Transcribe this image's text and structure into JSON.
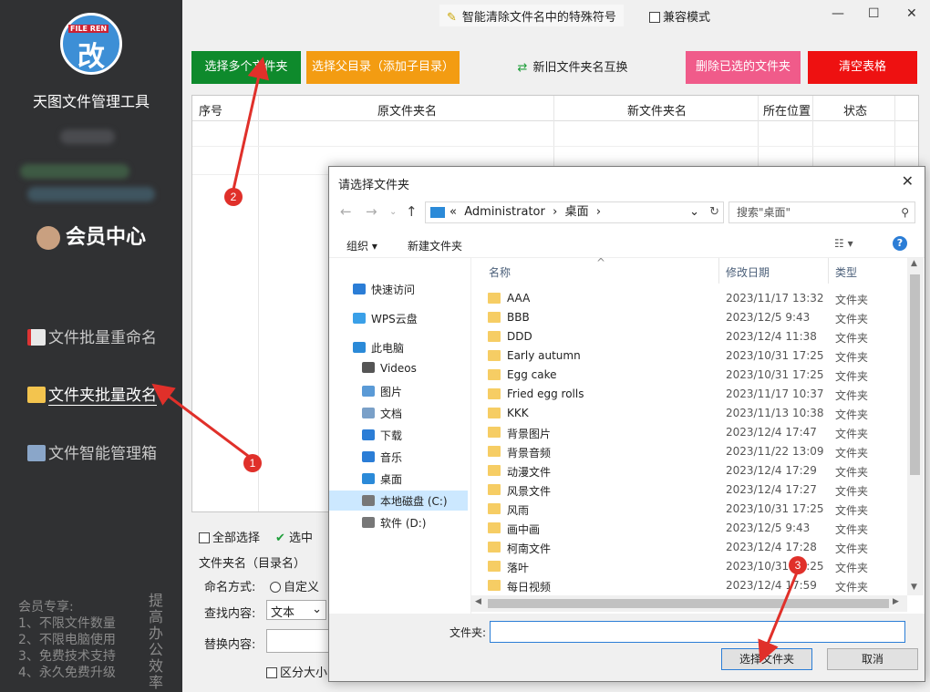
{
  "sidebar": {
    "logo_tag": "FILE REN",
    "logo_char": "改",
    "app_name": "天图文件管理工具",
    "member_center": "会员中心",
    "nav": [
      {
        "label": "文件批量重命名"
      },
      {
        "label": "文件夹批量改名"
      },
      {
        "label": "文件智能管理箱"
      }
    ],
    "vip_lines": [
      "会员专享:",
      "1、不限文件数量",
      "2、不限电脑使用",
      "3、免费技术支持",
      "4、永久免费升级"
    ],
    "vip_side": "提高办公效率"
  },
  "header": {
    "title": "智能清除文件名中的特殊符号",
    "compat_mode": "兼容模式"
  },
  "toolbar": {
    "select_multiple": "选择多个文件夹",
    "select_parent": "选择父目录（添加子目录）",
    "swap": "新旧文件夹名互换",
    "delete_selected": "删除已选的文件夹",
    "clear_table": "清空表格"
  },
  "table": {
    "columns": [
      "序号",
      "原文件夹名",
      "新文件夹名",
      "所在位置",
      "状态"
    ]
  },
  "bottom": {
    "select_all": "全部选择",
    "selected": "选中",
    "folder_name_label": "文件夹名（目录名）",
    "naming_mode": "命名方式:",
    "custom": "自定义",
    "find": "查找内容:",
    "find_type": "文本",
    "replace": "替换内容:",
    "case_sensitive": "区分大小写"
  },
  "dialog": {
    "title": "请选择文件夹",
    "address": [
      "«",
      "Administrator",
      "›",
      "桌面",
      "›"
    ],
    "search_placeholder": "搜索\"桌面\"",
    "organize": "组织 ▾",
    "new_folder": "新建文件夹",
    "tree": [
      {
        "label": "快速访问",
        "color": "#2b7dd6"
      },
      {
        "label": "WPS云盘",
        "color": "#3aa0e8"
      },
      {
        "label": "此电脑",
        "color": "#2b8ad8"
      },
      {
        "label": "Videos",
        "color": "#555"
      },
      {
        "label": "图片",
        "color": "#5a9ad6"
      },
      {
        "label": "文档",
        "color": "#7aa0c8"
      },
      {
        "label": "下载",
        "color": "#2b7dd6"
      },
      {
        "label": "音乐",
        "color": "#2b7dd6"
      },
      {
        "label": "桌面",
        "color": "#2b8ad8"
      },
      {
        "label": "本地磁盘 (C:)",
        "color": "#777"
      },
      {
        "label": "软件 (D:)",
        "color": "#777"
      }
    ],
    "col_name": "名称",
    "col_date": "修改日期",
    "col_type": "类型",
    "files": [
      {
        "name": "AAA",
        "date": "2023/11/17 13:32",
        "type": "文件夹"
      },
      {
        "name": "BBB",
        "date": "2023/12/5 9:43",
        "type": "文件夹"
      },
      {
        "name": "DDD",
        "date": "2023/12/4 11:38",
        "type": "文件夹"
      },
      {
        "name": "Early autumn",
        "date": "2023/10/31 17:25",
        "type": "文件夹"
      },
      {
        "name": "Egg cake",
        "date": "2023/10/31 17:25",
        "type": "文件夹"
      },
      {
        "name": "Fried egg rolls",
        "date": "2023/11/17 10:37",
        "type": "文件夹"
      },
      {
        "name": "KKK",
        "date": "2023/11/13 10:38",
        "type": "文件夹"
      },
      {
        "name": "背景图片",
        "date": "2023/12/4 17:47",
        "type": "文件夹"
      },
      {
        "name": "背景音频",
        "date": "2023/11/22 13:09",
        "type": "文件夹"
      },
      {
        "name": "动漫文件",
        "date": "2023/12/4 17:29",
        "type": "文件夹"
      },
      {
        "name": "风景文件",
        "date": "2023/12/4 17:27",
        "type": "文件夹"
      },
      {
        "name": "风雨",
        "date": "2023/10/31 17:25",
        "type": "文件夹"
      },
      {
        "name": "画中画",
        "date": "2023/12/5 9:43",
        "type": "文件夹"
      },
      {
        "name": "柯南文件",
        "date": "2023/12/4 17:28",
        "type": "文件夹"
      },
      {
        "name": "落叶",
        "date": "2023/10/31 17:25",
        "type": "文件夹"
      },
      {
        "name": "每日视频",
        "date": "2023/12/4 17:59",
        "type": "文件夹"
      }
    ],
    "filename_label": "文件夹:",
    "filename_value": "",
    "ok": "选择文件夹",
    "cancel": "取消"
  },
  "markers": [
    "1",
    "2",
    "3"
  ]
}
